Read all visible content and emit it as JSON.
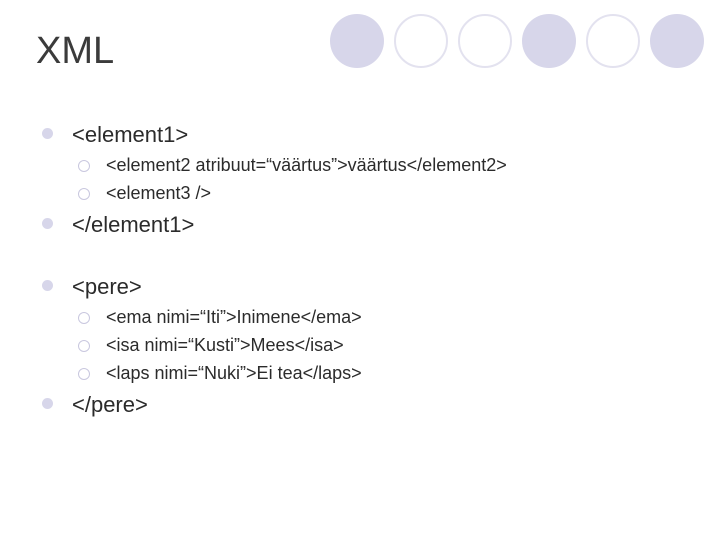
{
  "title": "XML",
  "circles": [
    {
      "style": "filled"
    },
    {
      "style": "outline"
    },
    {
      "style": "outline"
    },
    {
      "style": "filled"
    },
    {
      "style": "outline"
    },
    {
      "style": "filled"
    }
  ],
  "colors": {
    "bullet_filled": "#d7d6ea",
    "bullet_outline": "#c9c8df"
  },
  "block1": {
    "open": "<element1>",
    "sub": [
      "<element2 atribuut=“väärtus”>väärtus</element2>",
      "<element3 />"
    ],
    "close": "</element1>"
  },
  "block2": {
    "open": "<pere>",
    "sub": [
      "<ema nimi=“Iti”>Inimene</ema>",
      "<isa nimi=“Kusti”>Mees</isa>",
      "<laps nimi=“Nuki”>Ei tea</laps>"
    ],
    "close": "</pere>"
  }
}
